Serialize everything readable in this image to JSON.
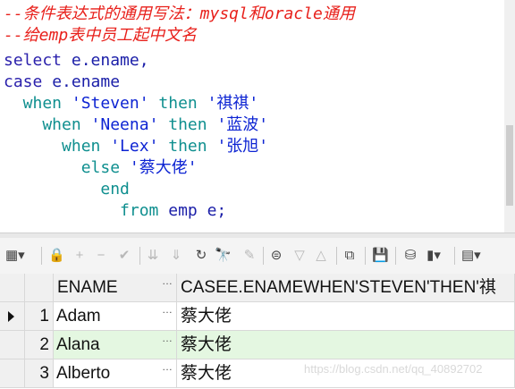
{
  "editor": {
    "lines": [
      {
        "segments": [
          {
            "cls": "c-comment",
            "text": "--条件表达式的通用写法：mysql和oracle通用"
          }
        ]
      },
      {
        "segments": [
          {
            "cls": "c-comment",
            "text": "--给emp表中员工起中文名"
          }
        ]
      },
      {
        "segments": [
          {
            "cls": "c-kw",
            "text": "select "
          },
          {
            "cls": "c-plain",
            "text": "e.ename,"
          }
        ]
      },
      {
        "segments": [
          {
            "cls": "c-kw",
            "text": "case "
          },
          {
            "cls": "c-plain",
            "text": "e.ename"
          }
        ]
      },
      {
        "segments": [
          {
            "cls": "c-kw2",
            "text": "  when "
          },
          {
            "cls": "c-str",
            "text": "'Steven' "
          },
          {
            "cls": "c-kw2",
            "text": "then "
          },
          {
            "cls": "c-str",
            "text": "'祺祺'"
          }
        ]
      },
      {
        "segments": [
          {
            "cls": "c-kw2",
            "text": "    when "
          },
          {
            "cls": "c-str",
            "text": "'Neena' "
          },
          {
            "cls": "c-kw2",
            "text": "then "
          },
          {
            "cls": "c-str",
            "text": "'蓝波'"
          }
        ]
      },
      {
        "segments": [
          {
            "cls": "c-kw2",
            "text": "      when "
          },
          {
            "cls": "c-str",
            "text": "'Lex' "
          },
          {
            "cls": "c-kw2",
            "text": "then "
          },
          {
            "cls": "c-str",
            "text": "'张旭'"
          }
        ]
      },
      {
        "segments": [
          {
            "cls": "c-kw2",
            "text": "        else "
          },
          {
            "cls": "c-str",
            "text": "'蔡大佬'"
          }
        ]
      },
      {
        "segments": [
          {
            "cls": "c-kw2",
            "text": "          end"
          }
        ]
      },
      {
        "segments": [
          {
            "cls": "c-kw2",
            "text": "            from "
          },
          {
            "cls": "c-plain",
            "text": "emp e;"
          }
        ]
      }
    ]
  },
  "toolbar": {
    "buttons": [
      {
        "name": "grid-view-icon",
        "glyph": "▦▾"
      },
      {
        "name": "lock-icon",
        "glyph": "🔒"
      },
      {
        "name": "add-record-icon",
        "glyph": "+"
      },
      {
        "name": "delete-record-icon",
        "glyph": "−"
      },
      {
        "name": "post-changes-icon",
        "glyph": "✔"
      },
      {
        "name": "fetch-next-icon",
        "glyph": "⇊"
      },
      {
        "name": "fetch-last-icon",
        "glyph": "⇓"
      },
      {
        "name": "refresh-icon",
        "glyph": "↻"
      },
      {
        "name": "find-icon",
        "glyph": "🔭"
      },
      {
        "name": "clear-icon",
        "glyph": "✎"
      },
      {
        "name": "query-by-example-icon",
        "glyph": "⊜"
      },
      {
        "name": "sort-descending-icon",
        "glyph": "▽"
      },
      {
        "name": "sort-ascending-icon",
        "glyph": "△"
      },
      {
        "name": "tree-view-icon",
        "glyph": "⧉"
      },
      {
        "name": "save-icon",
        "glyph": "💾"
      },
      {
        "name": "export-icon",
        "glyph": "⛁"
      },
      {
        "name": "chart-icon",
        "glyph": "▮▾"
      },
      {
        "name": "table-menu-icon",
        "glyph": "▤▾"
      }
    ]
  },
  "grid": {
    "columns": [
      "ENAME",
      "CASEE.ENAMEWHEN'STEVEN'THEN'祺"
    ],
    "cell_dots": "…",
    "rows": [
      {
        "num": "1",
        "ename": "Adam",
        "case": "蔡大佬"
      },
      {
        "num": "2",
        "ename": "Alana",
        "case": "蔡大佬"
      },
      {
        "num": "3",
        "ename": "Alberto",
        "case": "蔡大佬"
      }
    ]
  },
  "watermark": "https://blog.csdn.net/qq_40892702"
}
